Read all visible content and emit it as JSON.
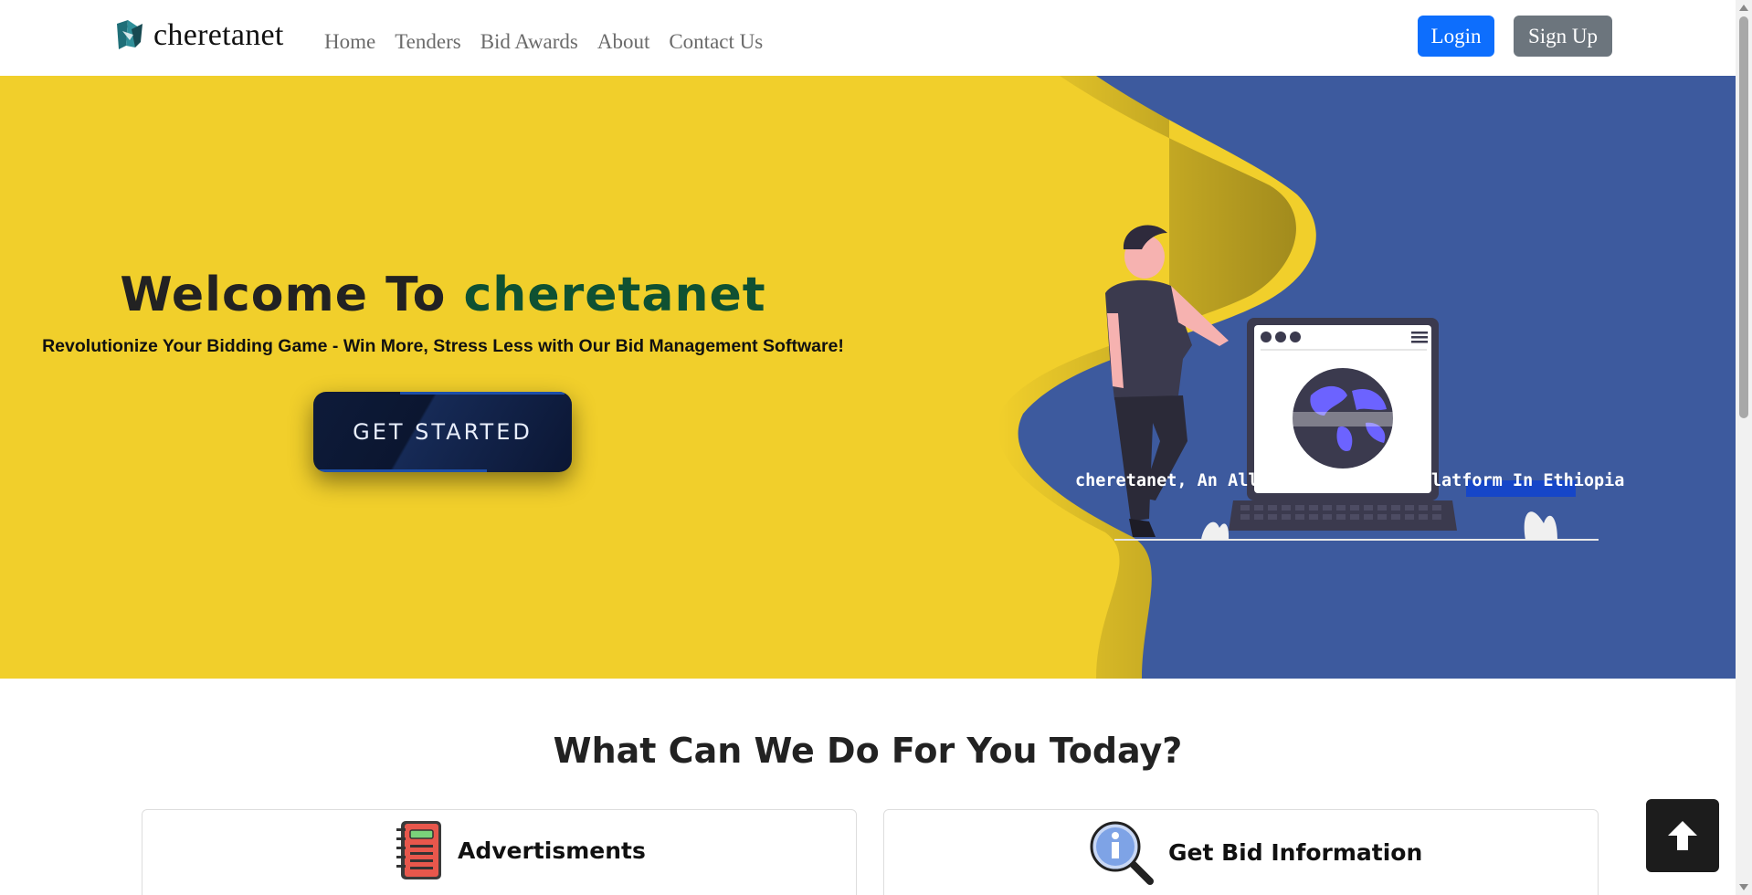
{
  "brand": {
    "name": "cheretanet"
  },
  "nav": {
    "items": [
      "Home",
      "Tenders",
      "Bid Awards",
      "About",
      "Contact Us"
    ]
  },
  "auth": {
    "login_label": "Login",
    "signup_label": "Sign Up"
  },
  "hero": {
    "title_prefix": "Welcome To",
    "title_accent": "cheretanet",
    "subtitle": "Revolutionize Your Bidding Game - Win More, Stress Less with Our Bid Management Software!",
    "cta_label": "GET STARTED",
    "caption": "cheretanet, An All-In-One Bidding Platform In Ethiopia"
  },
  "services": {
    "title": "What Can We Do For You Today?",
    "cards": [
      {
        "label": "Advertisments",
        "icon": "notebook-icon"
      },
      {
        "label": "Get Bid Information",
        "icon": "info-magnifier-icon"
      }
    ]
  },
  "colors": {
    "hero_yellow": "#f1cf2b",
    "hero_blue": "#3d5a9e",
    "accent_green": "#0f5132",
    "login_blue": "#0d6efd",
    "signup_gray": "#6c757d"
  }
}
